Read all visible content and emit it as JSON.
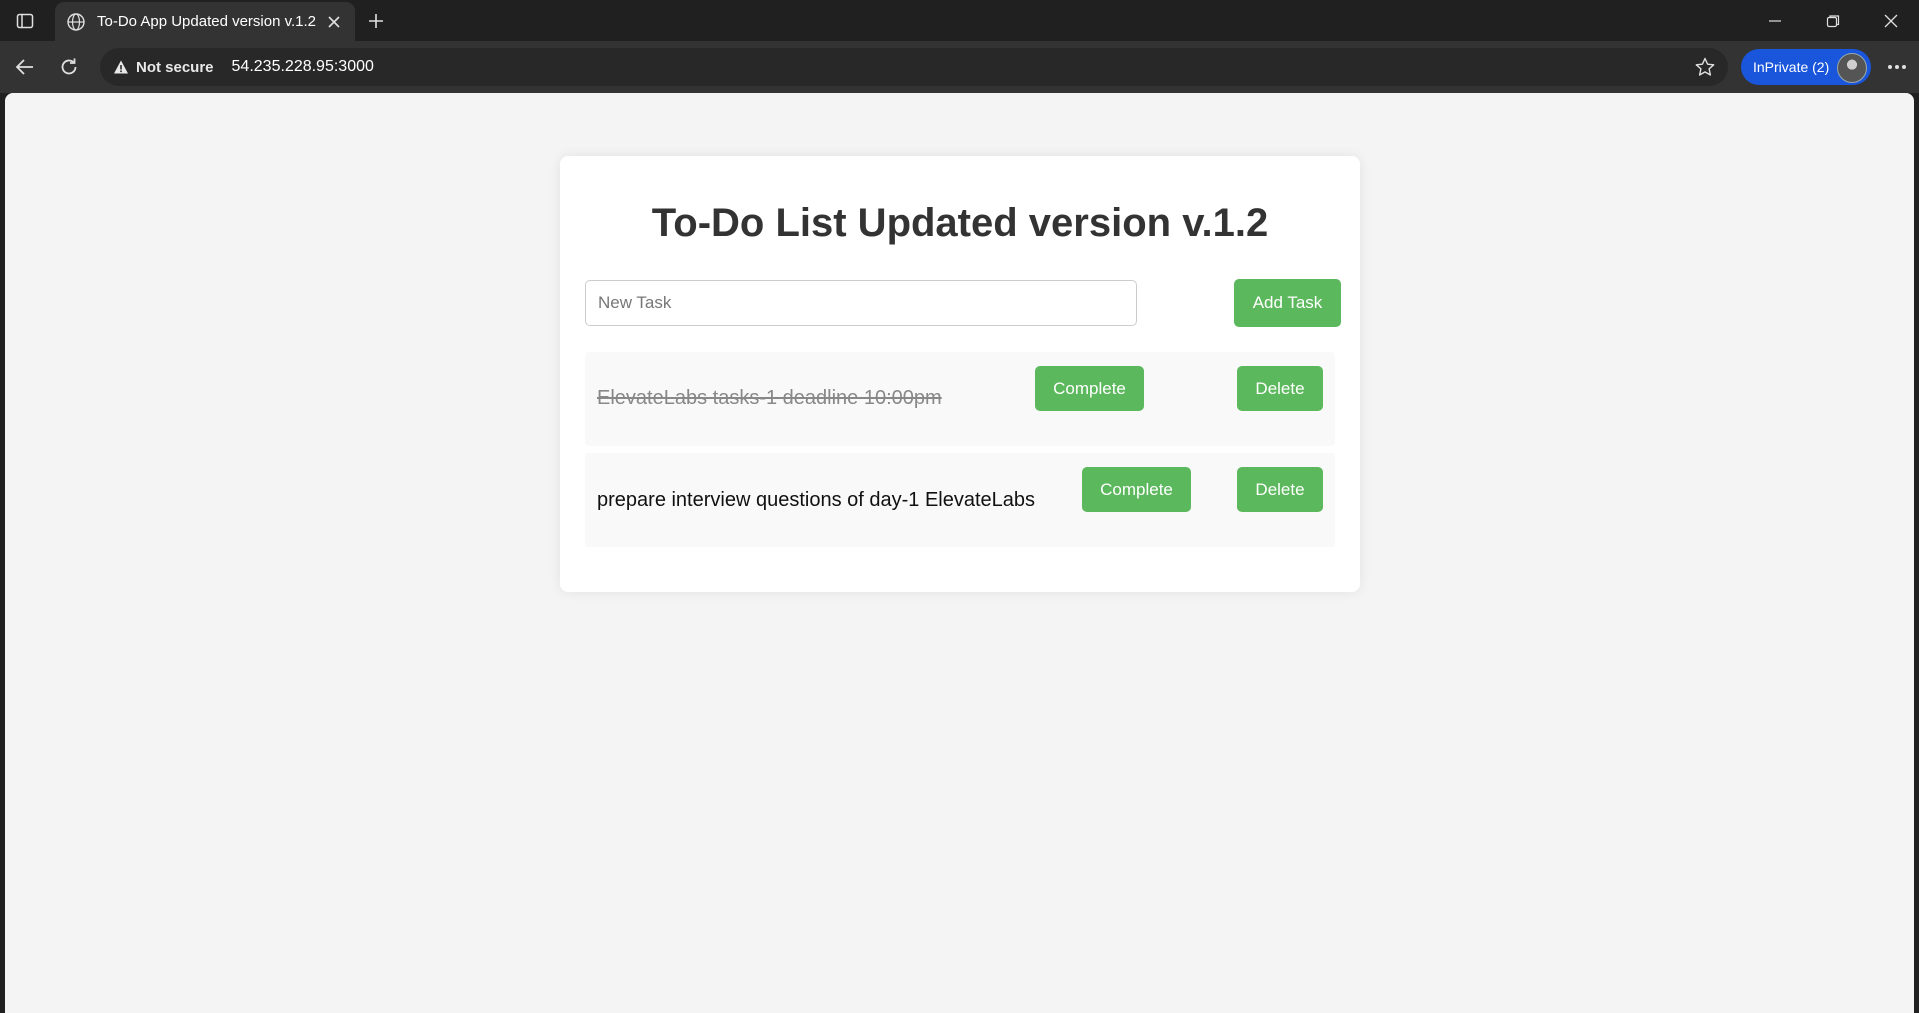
{
  "browser": {
    "tab_title": "To-Do App Updated version v.1.2",
    "security_label": "Not secure",
    "url": "54.235.228.95:3000",
    "inprivate_label": "InPrivate (2)"
  },
  "app": {
    "title": "To-Do List Updated version v.1.2",
    "input_placeholder": "New Task",
    "input_value": "",
    "add_button_label": "Add Task",
    "accent_color": "#5cb85c",
    "tasks": [
      {
        "text": "ElevateLabs tasks-1 deadline 10:00pm",
        "completed": true,
        "complete_label": "Complete",
        "delete_label": "Delete"
      },
      {
        "text": "prepare interview questions of day-1 ElevateLabs",
        "completed": false,
        "complete_label": "Complete",
        "delete_label": "Delete"
      }
    ]
  }
}
